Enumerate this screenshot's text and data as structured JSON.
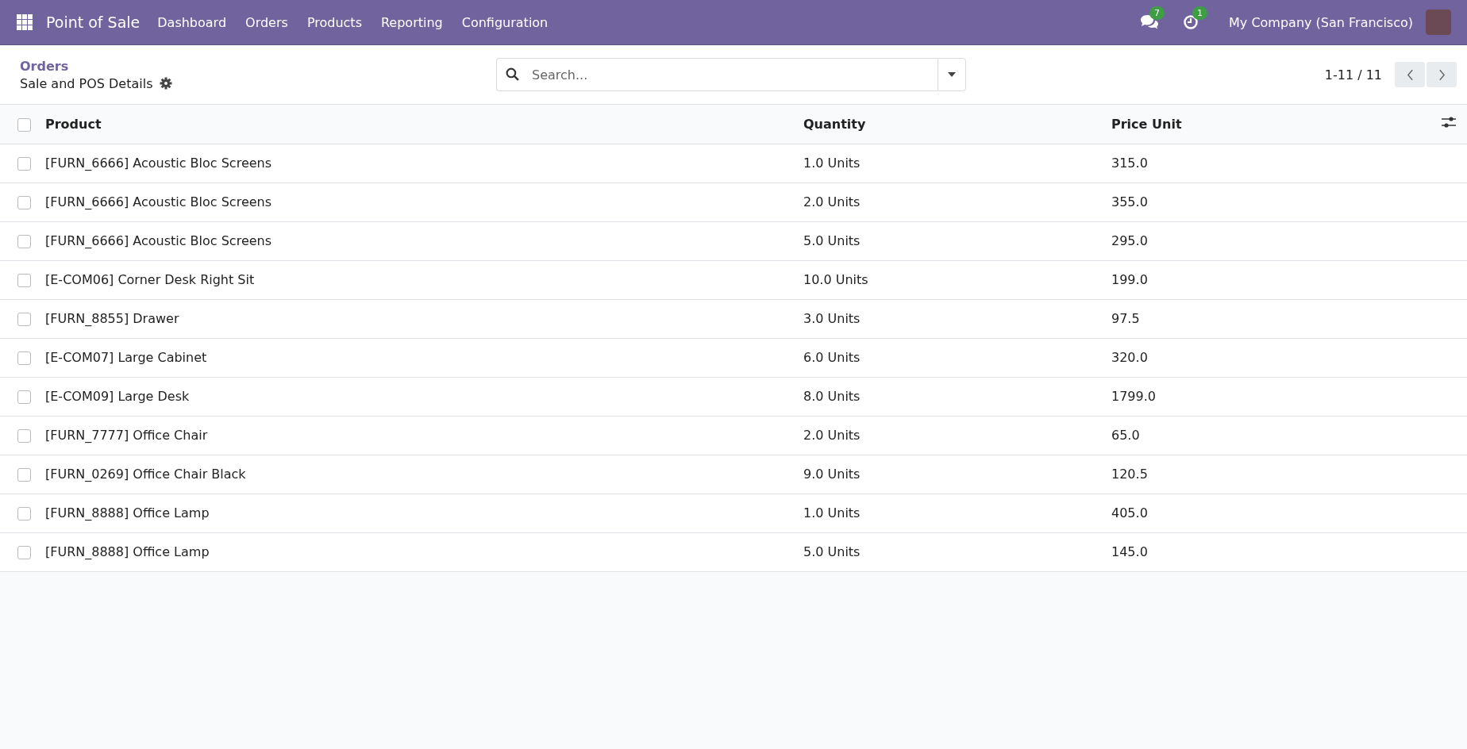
{
  "navbar": {
    "app_name": "Point of Sale",
    "menu": [
      "Dashboard",
      "Orders",
      "Products",
      "Reporting",
      "Configuration"
    ],
    "messages_badge": "7",
    "activities_badge": "1",
    "company": "My Company (San Francisco)"
  },
  "breadcrumb": {
    "parent": "Orders",
    "current": "Sale and POS Details"
  },
  "search": {
    "placeholder": "Search..."
  },
  "pager": {
    "range": "1-11 / 11"
  },
  "table": {
    "columns": [
      "Product",
      "Quantity",
      "Price Unit"
    ],
    "all_checked": false,
    "rows": [
      {
        "product": "[FURN_6666] Acoustic Bloc Screens",
        "quantity": "1.0 Units",
        "price_unit": "315.0",
        "checked": false
      },
      {
        "product": "[FURN_6666] Acoustic Bloc Screens",
        "quantity": "2.0 Units",
        "price_unit": "355.0",
        "checked": false
      },
      {
        "product": "[FURN_6666] Acoustic Bloc Screens",
        "quantity": "5.0 Units",
        "price_unit": "295.0",
        "checked": false
      },
      {
        "product": "[E-COM06] Corner Desk Right Sit",
        "quantity": "10.0 Units",
        "price_unit": "199.0",
        "checked": false
      },
      {
        "product": "[FURN_8855] Drawer",
        "quantity": "3.0 Units",
        "price_unit": "97.5",
        "checked": false
      },
      {
        "product": "[E-COM07] Large Cabinet",
        "quantity": "6.0 Units",
        "price_unit": "320.0",
        "checked": false
      },
      {
        "product": "[E-COM09] Large Desk",
        "quantity": "8.0 Units",
        "price_unit": "1799.0",
        "checked": false
      },
      {
        "product": "[FURN_7777] Office Chair",
        "quantity": "2.0 Units",
        "price_unit": "65.0",
        "checked": false
      },
      {
        "product": "[FURN_0269] Office Chair Black",
        "quantity": "9.0 Units",
        "price_unit": "120.5",
        "checked": false
      },
      {
        "product": "[FURN_8888] Office Lamp",
        "quantity": "1.0 Units",
        "price_unit": "405.0",
        "checked": false
      },
      {
        "product": "[FURN_8888] Office Lamp",
        "quantity": "5.0 Units",
        "price_unit": "145.0",
        "checked": false
      }
    ]
  }
}
